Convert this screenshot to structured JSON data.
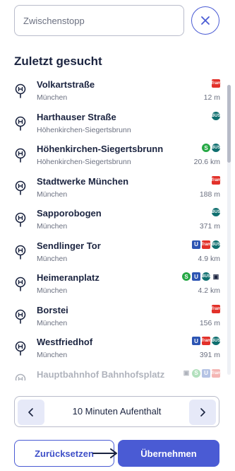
{
  "search": {
    "placeholder": "Zwischenstopp",
    "value": ""
  },
  "close_icon": "close-icon",
  "recent": {
    "heading": "Zuletzt gesucht",
    "items": [
      {
        "name": "Volkartstraße",
        "place": "München",
        "distance": "12 m",
        "modes": [
          "tram"
        ]
      },
      {
        "name": "Harthauser Straße",
        "place": "Höhenkirchen-Siegertsbrunn",
        "distance": "",
        "modes": [
          "bus"
        ]
      },
      {
        "name": "Höhenkirchen-Siegertsbrunn",
        "place": "Höhenkirchen-Siegertsbrunn",
        "distance": "20.6 km",
        "modes": [
          "s",
          "bus"
        ]
      },
      {
        "name": "Stadtwerke München",
        "place": "München",
        "distance": "188 m",
        "modes": [
          "tram"
        ]
      },
      {
        "name": "Sapporobogen",
        "place": "München",
        "distance": "371 m",
        "modes": [
          "bus"
        ]
      },
      {
        "name": "Sendlinger Tor",
        "place": "München",
        "distance": "4.9 km",
        "modes": [
          "u",
          "tram",
          "bus"
        ]
      },
      {
        "name": "Heimeranplatz",
        "place": "München",
        "distance": "4.2 km",
        "modes": [
          "s",
          "u",
          "bus",
          "train"
        ]
      },
      {
        "name": "Borstei",
        "place": "München",
        "distance": "156 m",
        "modes": [
          "tram"
        ]
      },
      {
        "name": "Westfriedhof",
        "place": "München",
        "distance": "391 m",
        "modes": [
          "u",
          "tram",
          "bus"
        ]
      },
      {
        "name": "Hauptbahnhof Bahnhofsplatz",
        "place": "",
        "distance": "",
        "modes": [
          "train",
          "s",
          "u",
          "tram"
        ]
      }
    ]
  },
  "mode_labels": {
    "tram": "Tram",
    "bus": "BUS",
    "s": "S",
    "u": "U",
    "train": "▣"
  },
  "stay": {
    "label": "10 Minuten Aufenthalt",
    "prev_icon": "chevron-left-icon",
    "next_icon": "chevron-right-icon"
  },
  "actions": {
    "reset_label": "Zurücksetzen",
    "apply_label": "Übernehmen"
  },
  "colors": {
    "accent": "#4a5bd4",
    "tram": "#e2312a",
    "bus": "#0f6f6f",
    "sbahn": "#26a845",
    "ubahn": "#2d55b3"
  }
}
